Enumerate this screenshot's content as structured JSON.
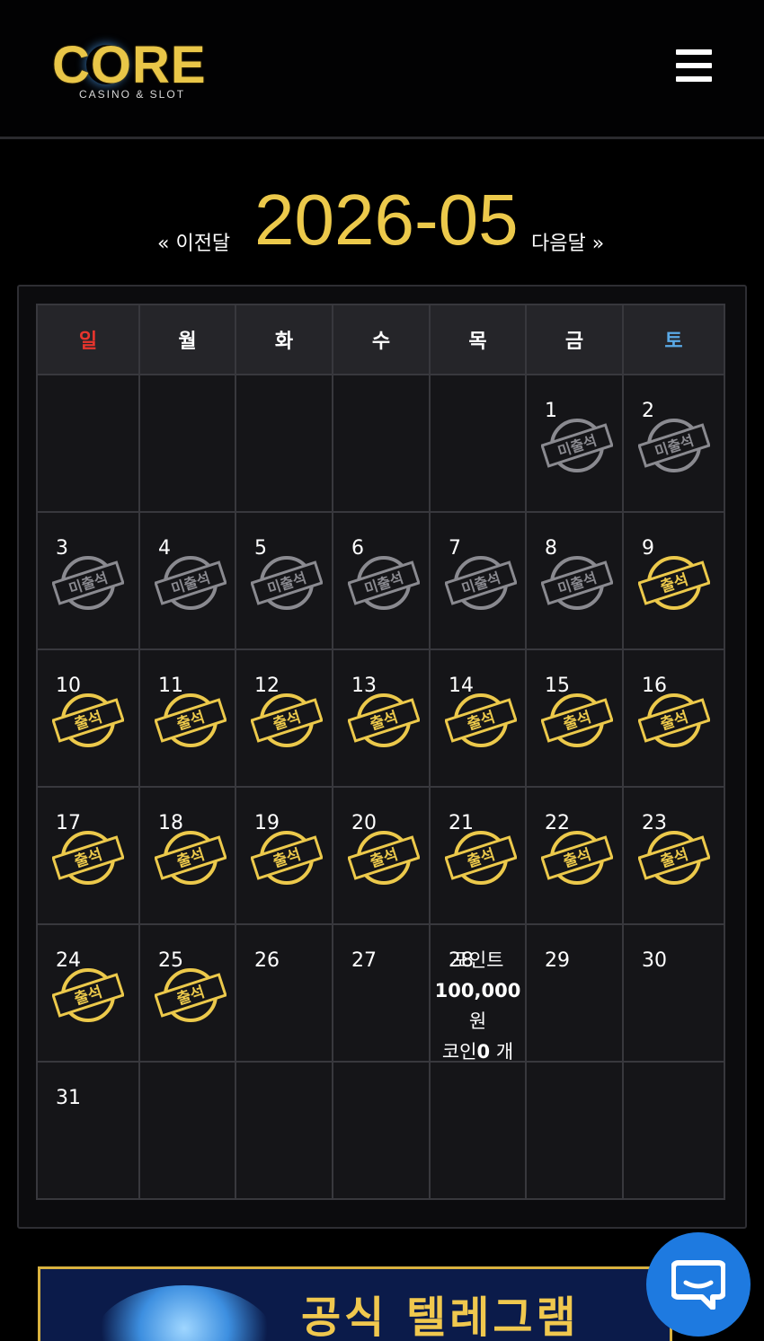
{
  "header": {
    "logo_text": "CORE",
    "logo_sub": "CASINO & SLOT",
    "menu_icon": "hamburger-menu-icon"
  },
  "month_nav": {
    "prev_label": "« 이전달",
    "title": "2026-05",
    "next_label": "다음달 »"
  },
  "calendar": {
    "weekdays": [
      "일",
      "월",
      "화",
      "수",
      "목",
      "금",
      "토"
    ],
    "stamp_missed_label": "미출석",
    "stamp_attended_label": "출석",
    "weeks": [
      [
        {
          "day": ""
        },
        {
          "day": ""
        },
        {
          "day": ""
        },
        {
          "day": ""
        },
        {
          "day": ""
        },
        {
          "day": "1",
          "stamp": "missed"
        },
        {
          "day": "2",
          "stamp": "missed"
        }
      ],
      [
        {
          "day": "3",
          "stamp": "missed"
        },
        {
          "day": "4",
          "stamp": "missed"
        },
        {
          "day": "5",
          "stamp": "missed"
        },
        {
          "day": "6",
          "stamp": "missed"
        },
        {
          "day": "7",
          "stamp": "missed"
        },
        {
          "day": "8",
          "stamp": "missed"
        },
        {
          "day": "9",
          "stamp": "attended"
        }
      ],
      [
        {
          "day": "10",
          "stamp": "attended"
        },
        {
          "day": "11",
          "stamp": "attended"
        },
        {
          "day": "12",
          "stamp": "attended"
        },
        {
          "day": "13",
          "stamp": "attended"
        },
        {
          "day": "14",
          "stamp": "attended"
        },
        {
          "day": "15",
          "stamp": "attended"
        },
        {
          "day": "16",
          "stamp": "attended"
        }
      ],
      [
        {
          "day": "17",
          "stamp": "attended"
        },
        {
          "day": "18",
          "stamp": "attended"
        },
        {
          "day": "19",
          "stamp": "attended"
        },
        {
          "day": "20",
          "stamp": "attended"
        },
        {
          "day": "21",
          "stamp": "attended"
        },
        {
          "day": "22",
          "stamp": "attended"
        },
        {
          "day": "23",
          "stamp": "attended"
        }
      ],
      [
        {
          "day": "24",
          "stamp": "attended"
        },
        {
          "day": "25",
          "stamp": "attended"
        },
        {
          "day": "26"
        },
        {
          "day": "27"
        },
        {
          "day": "28",
          "reward": true
        },
        {
          "day": "29"
        },
        {
          "day": "30"
        }
      ],
      [
        {
          "day": "31"
        },
        {
          "day": ""
        },
        {
          "day": ""
        },
        {
          "day": ""
        },
        {
          "day": ""
        },
        {
          "day": ""
        },
        {
          "day": ""
        }
      ]
    ],
    "reward": {
      "points_label": "포인트",
      "points_value": "100,000",
      "points_unit": "원",
      "coin_label": "코인",
      "coin_value": "0",
      "coin_unit": "개"
    }
  },
  "banner": {
    "text": "공식 텔레그램"
  },
  "chat": {
    "icon": "chat-bubble-icon"
  },
  "colors": {
    "accent_gold": "#ecc94b",
    "sunday_red": "#e8352d",
    "saturday_blue": "#5aa9e6",
    "missed_gray": "#8a8a90",
    "chat_blue": "#1e7ae0"
  }
}
